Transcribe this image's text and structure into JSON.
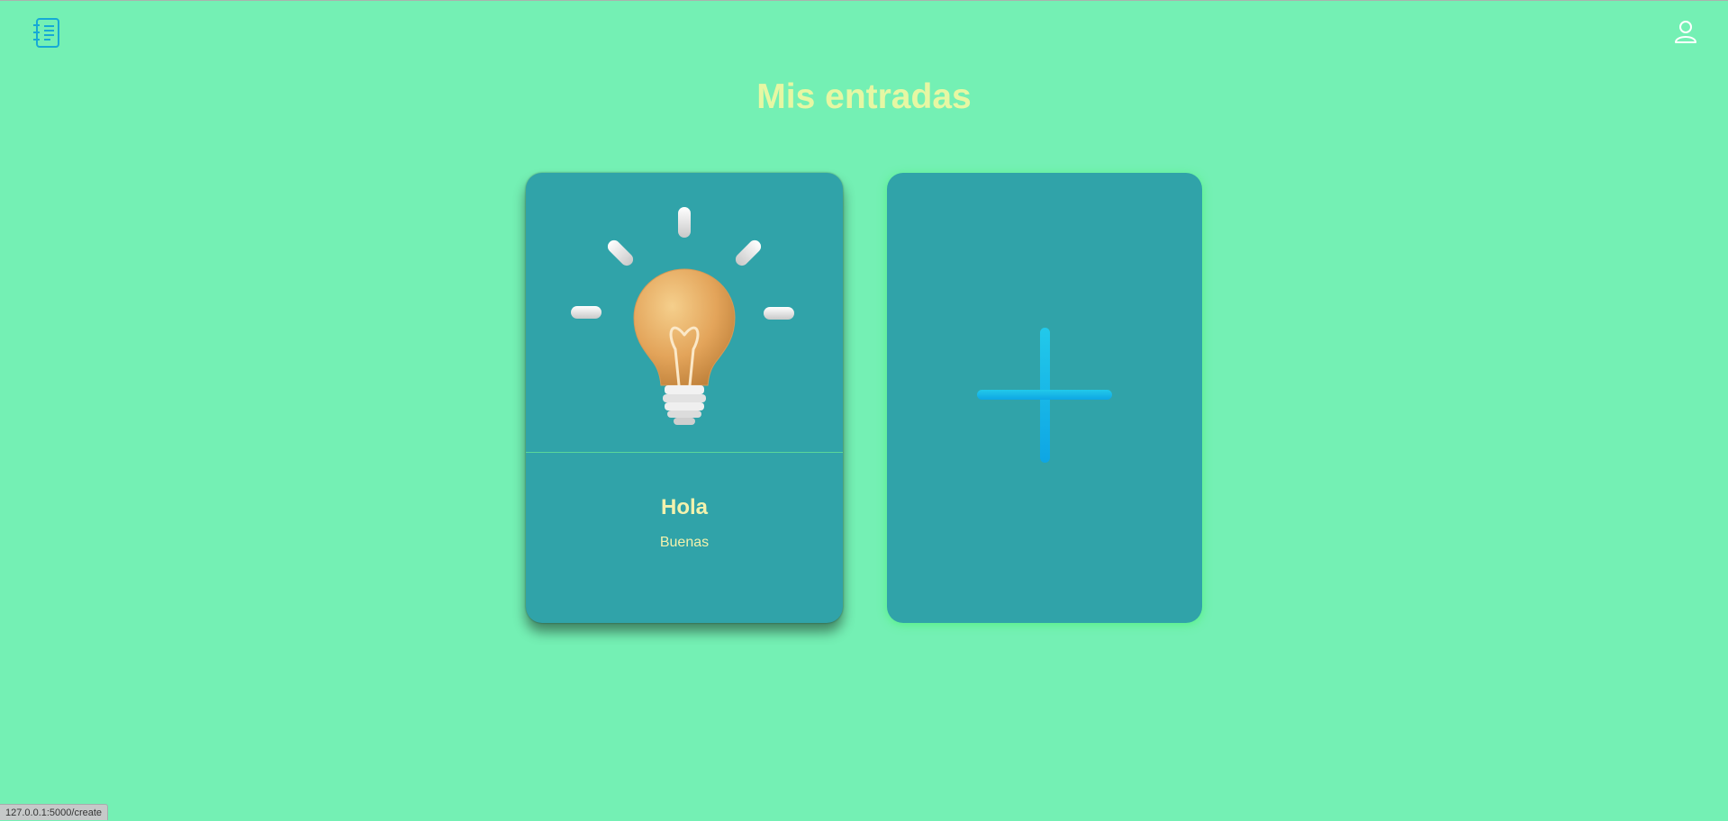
{
  "header": {
    "logo_icon": "journal-icon",
    "user_icon": "user-icon"
  },
  "page": {
    "title": "Mis entradas"
  },
  "entries": [
    {
      "image_icon": "lightbulb-icon",
      "title": "Hola",
      "subtitle": "Buenas"
    }
  ],
  "add_card": {
    "icon": "plus-icon"
  },
  "status_bar": {
    "url": "127.0.0.1:5000/create"
  },
  "colors": {
    "background": "#74f0b4",
    "card": "#30a3a9",
    "title": "#e6f7a3",
    "card_text": "#f3f2ad",
    "accent_icon": "#14b8e8"
  }
}
